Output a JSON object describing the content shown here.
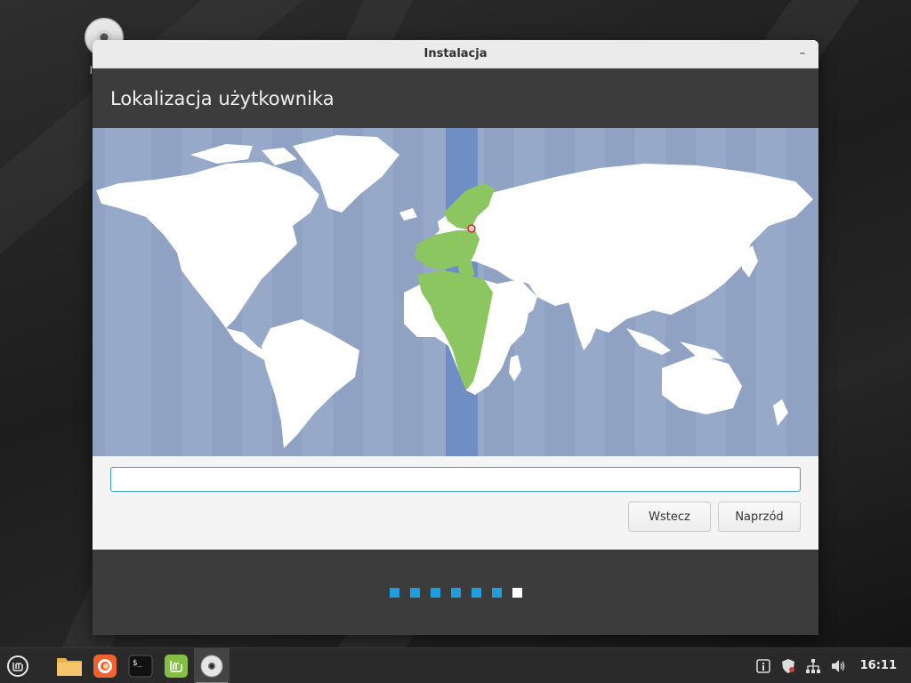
{
  "desktop": {
    "icon_label": "Instal"
  },
  "window": {
    "title": "Instalacja",
    "minimize_glyph": "–"
  },
  "page": {
    "title": "Lokalizacja użytkownika"
  },
  "timezone_input": {
    "value": "",
    "placeholder": ""
  },
  "buttons": {
    "back_label": "Wstecz",
    "next_label": "Naprzód"
  },
  "progress": {
    "total_steps": 7,
    "current_step": 7
  },
  "taskbar": {
    "items": [
      {
        "name": "menu",
        "icon": "mint-menu-icon"
      },
      {
        "name": "files",
        "icon": "folder-icon"
      },
      {
        "name": "firefox",
        "icon": "firefox-icon"
      },
      {
        "name": "terminal",
        "icon": "terminal-icon",
        "glyph": "$_"
      },
      {
        "name": "mint-welcome",
        "icon": "mint-logo-icon"
      },
      {
        "name": "installer",
        "icon": "disc-icon"
      }
    ],
    "clock": "16:11"
  },
  "colors": {
    "accent": "#1f9ede",
    "map_water": "#97a9c9",
    "map_land": "#ffffff",
    "map_highlight": "#8cc660",
    "timezone_band": "#6f8fc4"
  }
}
